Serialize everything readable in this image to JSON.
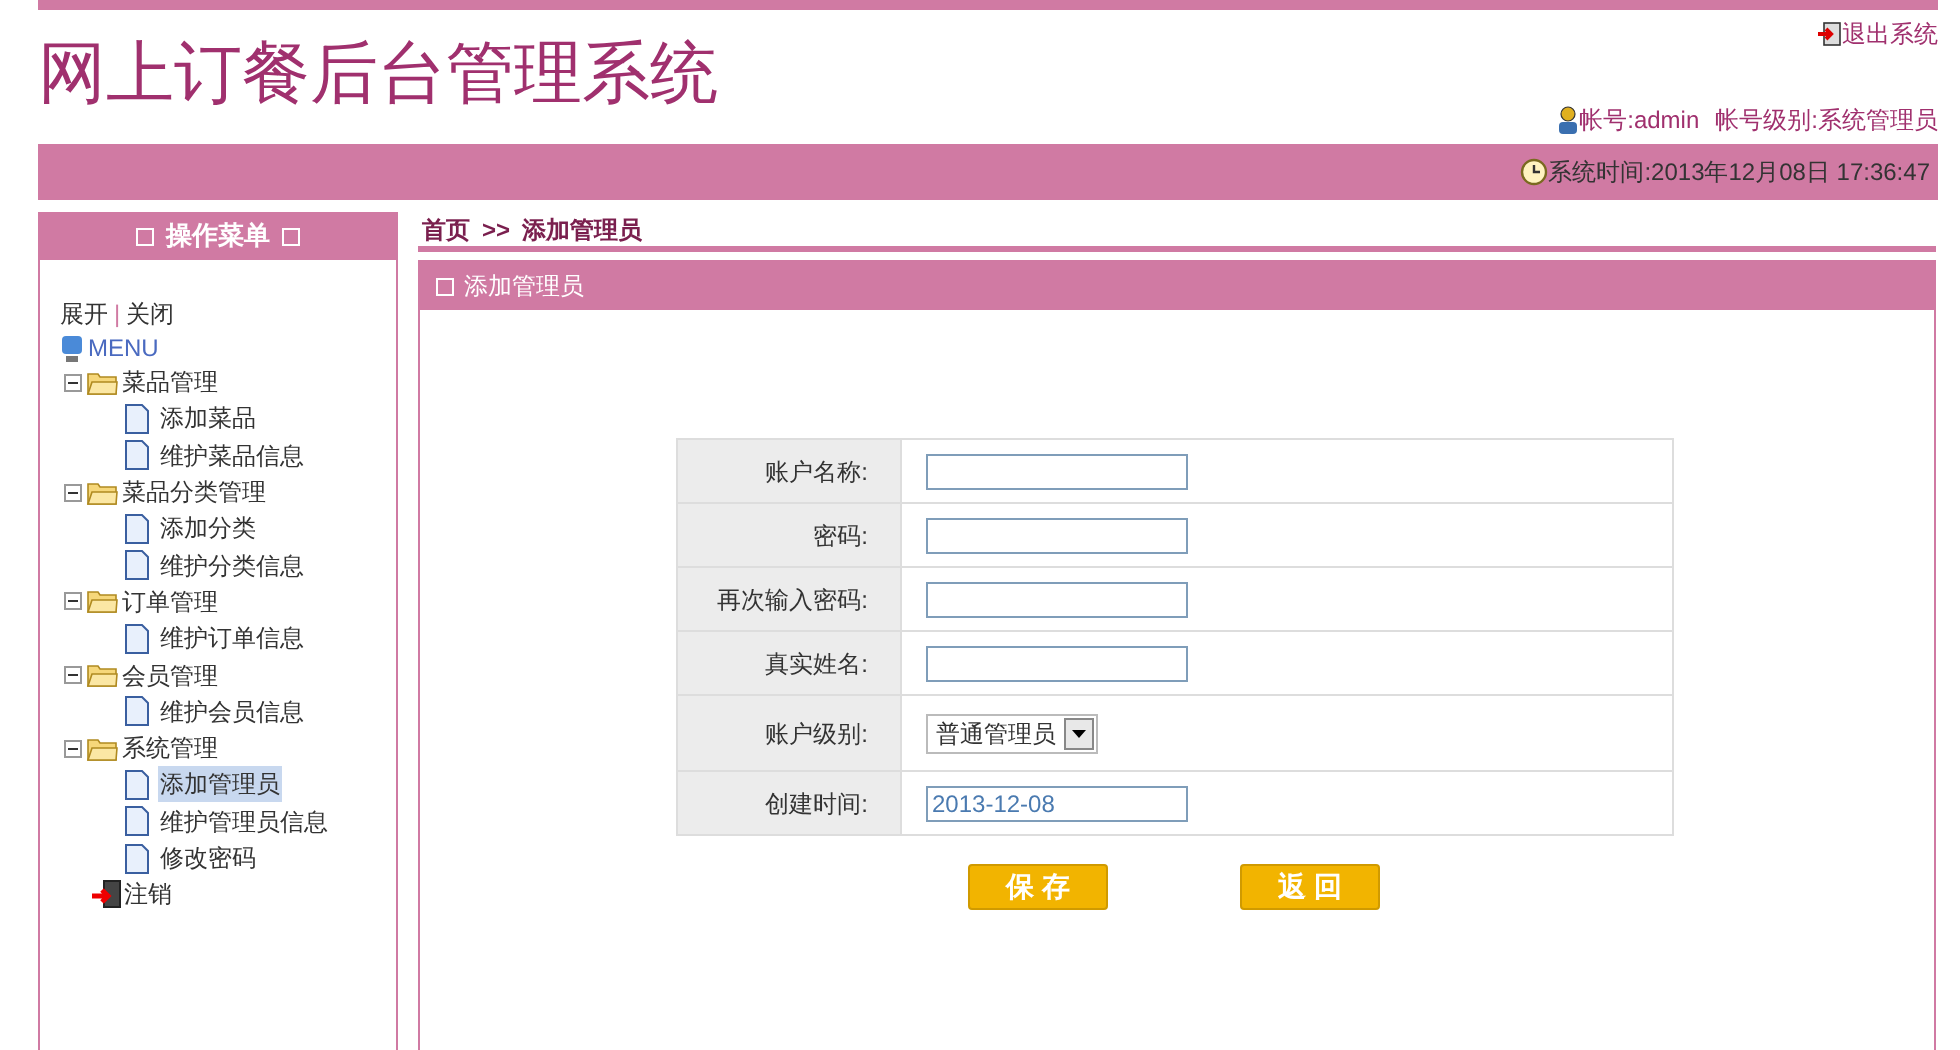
{
  "header": {
    "title": "网上订餐后台管理系统",
    "logout": "退出系统",
    "account": "帐号:admin",
    "account_level": "帐号级别:系统管理员",
    "system_time": "系统时间:2013年12月08日 17:36:47"
  },
  "sidebar": {
    "title": "操作菜单",
    "expand": "展开",
    "separator": "|",
    "collapse": "关闭",
    "tree": {
      "label": "MENU",
      "children": [
        {
          "label": "菜品管理",
          "kind": "folder",
          "expanded": true,
          "children": [
            {
              "label": "添加菜品",
              "kind": "page",
              "selected": false
            },
            {
              "label": "维护菜品信息",
              "kind": "page",
              "selected": false
            }
          ]
        },
        {
          "label": "菜品分类管理",
          "kind": "folder",
          "expanded": true,
          "children": [
            {
              "label": "添加分类",
              "kind": "page",
              "selected": false
            },
            {
              "label": "维护分类信息",
              "kind": "page",
              "selected": false
            }
          ]
        },
        {
          "label": "订单管理",
          "kind": "folder",
          "expanded": true,
          "children": [
            {
              "label": "维护订单信息",
              "kind": "page",
              "selected": false
            }
          ]
        },
        {
          "label": "会员管理",
          "kind": "folder",
          "expanded": true,
          "children": [
            {
              "label": "维护会员信息",
              "kind": "page",
              "selected": false
            }
          ]
        },
        {
          "label": "系统管理",
          "kind": "folder",
          "expanded": true,
          "children": [
            {
              "label": "添加管理员",
              "kind": "page",
              "selected": true
            },
            {
              "label": "维护管理员信息",
              "kind": "page",
              "selected": false
            },
            {
              "label": "修改密码",
              "kind": "page",
              "selected": false
            }
          ]
        },
        {
          "label": "注销",
          "kind": "exit"
        }
      ]
    }
  },
  "breadcrumb": {
    "home": "首页",
    "separator": ">>",
    "current": "添加管理员"
  },
  "panel": {
    "title": "添加管理员",
    "fields": [
      {
        "label": "账户名称:",
        "kind": "text"
      },
      {
        "label": "密码:",
        "kind": "text"
      },
      {
        "label": "再次输入密码:",
        "kind": "text"
      },
      {
        "label": "真实姓名:",
        "kind": "text"
      },
      {
        "label": "账户级别:",
        "kind": "select",
        "value": "普通管理员"
      },
      {
        "label": "创建时间:",
        "kind": "text",
        "value": "2013-12-08"
      }
    ],
    "buttons": [
      "保 存",
      "返 回"
    ]
  }
}
